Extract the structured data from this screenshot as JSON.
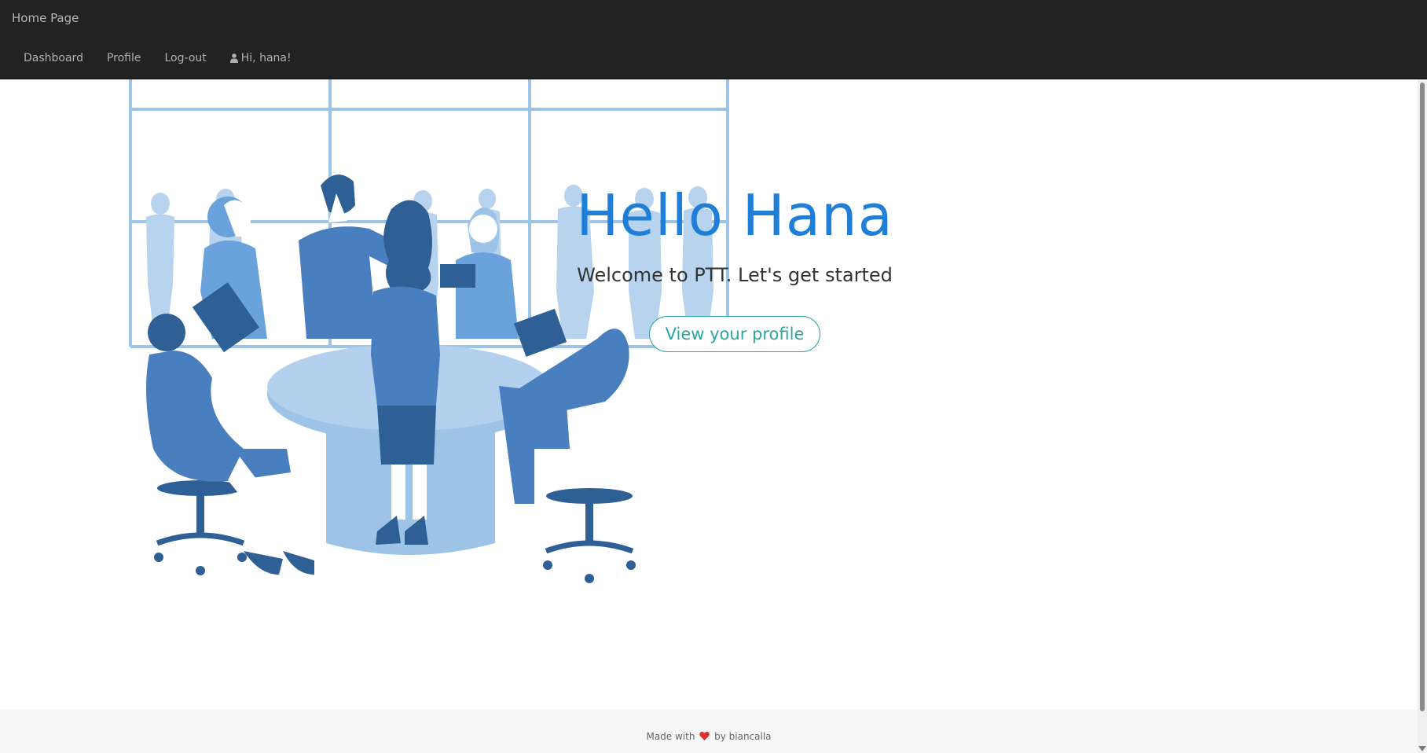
{
  "navbar": {
    "brand": "Home Page",
    "links": [
      {
        "label": "Dashboard"
      },
      {
        "label": "Profile"
      },
      {
        "label": "Log-out"
      }
    ],
    "greeting": "Hi, hana!",
    "greeting_icon": "user-icon"
  },
  "hero": {
    "title": "Hello Hana",
    "subtitle": "Welcome to PTT. Let's get started",
    "button_label": "View your profile",
    "illustration": "team-meeting-illustration"
  },
  "footer": {
    "prefix": "Made with",
    "icon": "heart-icon",
    "suffix": "by biancalla"
  },
  "colors": {
    "navbar_bg": "#222222",
    "title_blue": "#1f7fd8",
    "button_teal": "#2aa7a0",
    "heart_red": "#e03030",
    "illustration_dark": "#2e5f95",
    "illustration_mid": "#4a7fbf",
    "illustration_light": "#9dc3e6"
  }
}
